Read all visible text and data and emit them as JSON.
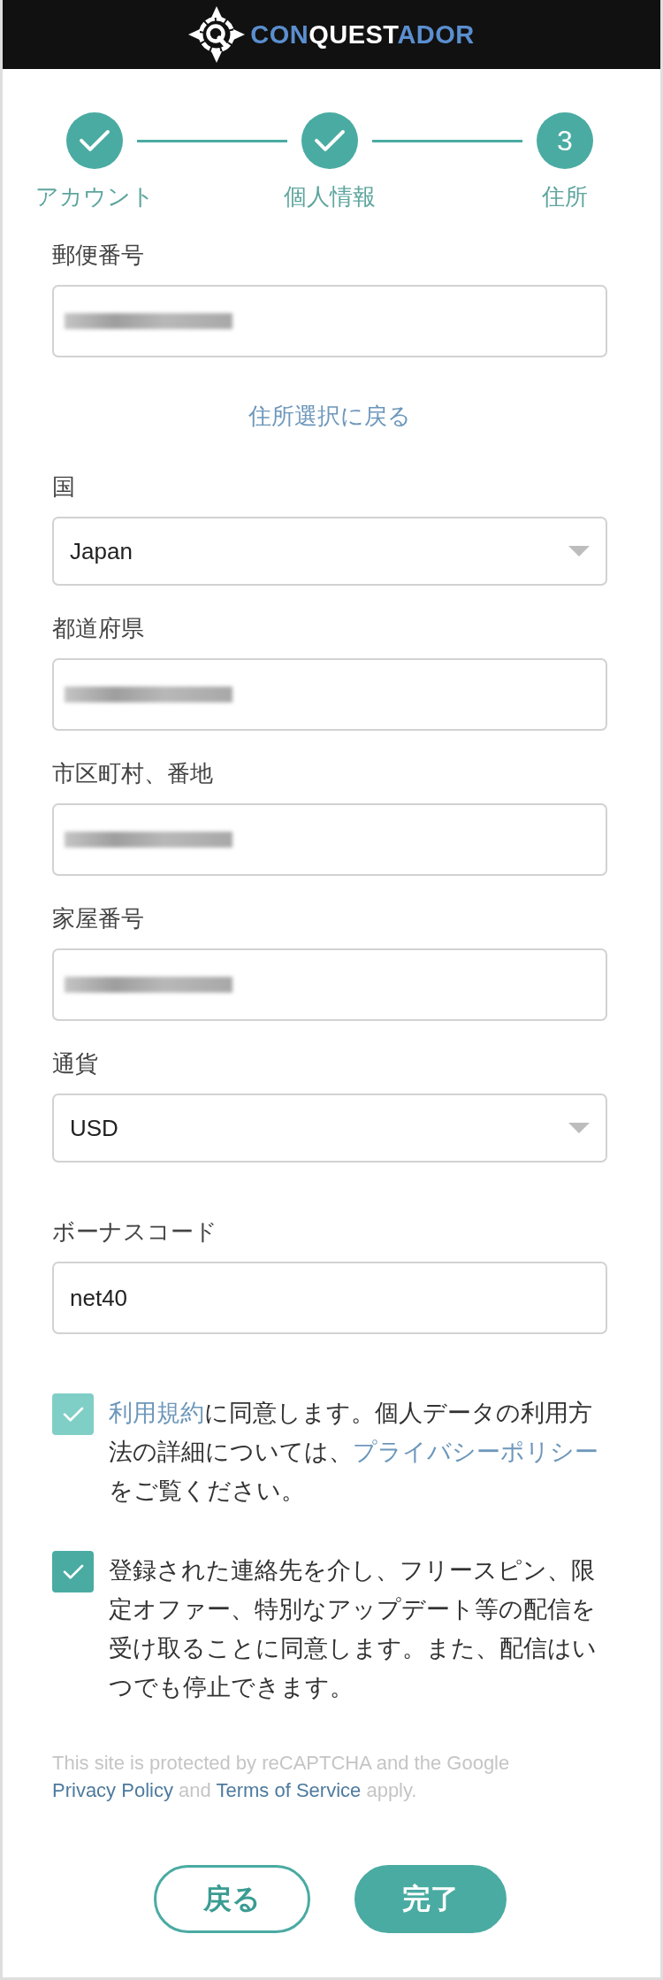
{
  "header": {
    "logo": {
      "parts": [
        {
          "text": "CON",
          "color": "#5b8fcf"
        },
        {
          "text": "QUEST",
          "color": "#ffffff"
        },
        {
          "text": "ADOR",
          "color": "#5b8fcf"
        }
      ]
    }
  },
  "steps": [
    {
      "label": "アカウント",
      "completed": true
    },
    {
      "label": "個人情報",
      "completed": true
    },
    {
      "label": "住所",
      "completed": false,
      "number": "3"
    }
  ],
  "fields": [
    {
      "kind": "input",
      "label": "郵便番号",
      "blurred": true
    },
    {
      "kind": "link",
      "text": "住所選択に戻る"
    },
    {
      "kind": "select",
      "label": "国",
      "value": "Japan"
    },
    {
      "kind": "input",
      "label": "都道府県",
      "blurred": true
    },
    {
      "kind": "input",
      "label": "市区町村、番地",
      "blurred": true
    },
    {
      "kind": "input",
      "label": "家屋番号",
      "blurred": true
    },
    {
      "kind": "select",
      "label": "通貨",
      "value": "USD"
    }
  ],
  "bonus_code": {
    "label": "ボーナスコード",
    "value": "net40"
  },
  "consents": [
    {
      "checked": true,
      "disabled": true,
      "segments": [
        {
          "text": "利用規約",
          "link": true
        },
        {
          "text": "に同意します。個人データの利用方法の詳細については、",
          "link": false
        },
        {
          "text": "プライバシーポリシー",
          "link": true
        },
        {
          "text": "をご覧ください。",
          "link": false
        }
      ]
    },
    {
      "checked": true,
      "disabled": false,
      "segments": [
        {
          "text": "登録された連絡先を介し、フリースピン、限定オファー、特別なアップデート等の配信を受け取ることに同意します。また、配信はいつでも停止できます。",
          "link": false
        }
      ]
    }
  ],
  "recaptcha": {
    "segments": [
      {
        "text": "This site is protected by reCAPTCHA and the Google ",
        "link": false
      },
      {
        "text": "Privacy Policy",
        "link": true
      },
      {
        "text": " and ",
        "link": false
      },
      {
        "text": "Terms of Service",
        "link": true
      },
      {
        "text": " apply.",
        "link": false
      }
    ]
  },
  "buttons": [
    {
      "label": "戻る",
      "kind": "outline"
    },
    {
      "label": "完了",
      "kind": "primary"
    }
  ]
}
